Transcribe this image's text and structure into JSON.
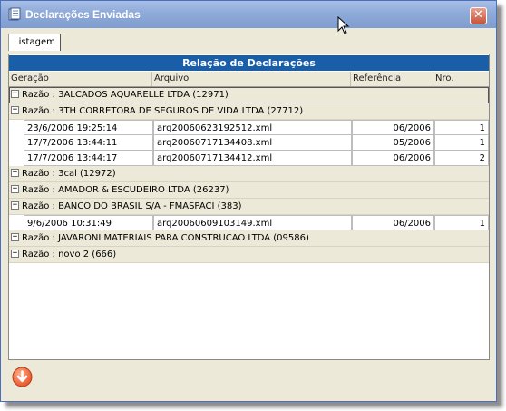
{
  "window": {
    "title": "Declarações Enviadas"
  },
  "tabs": [
    {
      "label": "Listagem"
    }
  ],
  "grid": {
    "title": "Relação de Declarações",
    "columns": {
      "geracao": "Geração",
      "arquivo": "Arquivo",
      "referencia": "Referência",
      "nro": "Nro."
    },
    "groups": [
      {
        "expander": "+",
        "label": "Razão : 3ALCADOS AQUARELLE LTDA (12971)",
        "rows": []
      },
      {
        "expander": "−",
        "label": "Razão : 3TH CORRETORA DE SEGUROS DE VIDA LTDA (27712)",
        "rows": [
          {
            "geracao": "23/6/2006 19:25:14",
            "arquivo": "arq20060623192512.xml",
            "referencia": "06/2006",
            "nro": "1"
          },
          {
            "geracao": "17/7/2006 13:44:11",
            "arquivo": "arq20060717134408.xml",
            "referencia": "05/2006",
            "nro": "1"
          },
          {
            "geracao": "17/7/2006 13:44:17",
            "arquivo": "arq20060717134412.xml",
            "referencia": "06/2006",
            "nro": "2"
          }
        ]
      },
      {
        "expander": "+",
        "label": "Razão : 3cal (12972)",
        "rows": []
      },
      {
        "expander": "+",
        "label": "Razão : AMADOR & ESCUDEIRO LTDA (26237)",
        "rows": []
      },
      {
        "expander": "−",
        "label": "Razão : BANCO DO BRASIL S/A - FMASPACI (383)",
        "rows": [
          {
            "geracao": "9/6/2006 10:31:49",
            "arquivo": "arq20060609103149.xml",
            "referencia": "06/2006",
            "nro": "1"
          }
        ]
      },
      {
        "expander": "+",
        "label": "Razão : JAVARONI MATERIAIS PARA CONSTRUCAO LTDA (09586)",
        "rows": []
      },
      {
        "expander": "+",
        "label": "Razão : novo 2 (666)",
        "rows": []
      }
    ]
  },
  "footer": {
    "button_icon": "down-arrow-circle-icon"
  },
  "colors": {
    "title_bar": "#8eaad8",
    "grid_header": "#1a5ea8",
    "close_button": "#c7553b",
    "footer_button": "#e8552a"
  }
}
